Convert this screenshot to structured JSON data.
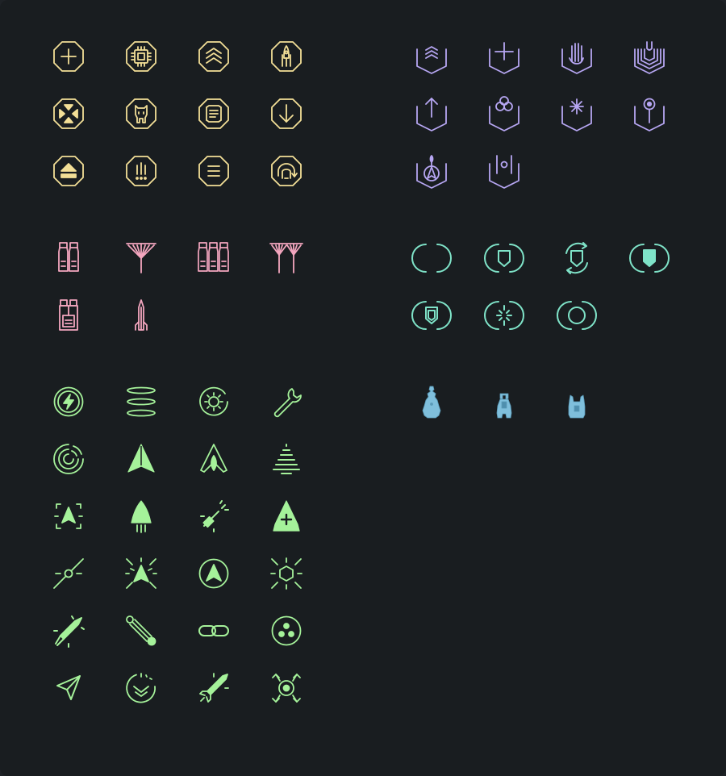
{
  "colors": {
    "background": "#191d20",
    "yellow": "#f3df97",
    "purple": "#b6a6f2",
    "pink": "#f4a6bf",
    "teal": "#7fe3c8",
    "blue": "#7fbfdc",
    "green": "#a5f29a"
  },
  "groups": [
    {
      "name": "yellow-octagon-icons",
      "color": "yellow",
      "icons": [
        "octagon-plus-icon",
        "octagon-chip-icon",
        "octagon-chevrons-up-icon",
        "octagon-rocket-icon",
        "octagon-target-icon",
        "octagon-robot-icon",
        "octagon-document-icon",
        "octagon-arrow-down-icon",
        "octagon-eject-icon",
        "octagon-alert-icon",
        "octagon-menu-icon",
        "octagon-refresh-icon"
      ]
    },
    {
      "name": "purple-shield-icons",
      "color": "purple",
      "icons": [
        "shield-chevrons-icon",
        "shield-plus-icon",
        "shield-hand-icon",
        "shield-layers-icon",
        "shield-arrow-up-icon",
        "shield-rings-icon",
        "shield-star-icon",
        "shield-pin-icon",
        "shield-rocket-icon",
        "shield-bar-icon"
      ]
    },
    {
      "name": "pink-structure-icons",
      "color": "pink",
      "icons": [
        "twin-tanks-icon",
        "single-antenna-icon",
        "triple-tanks-icon",
        "twin-antenna-icon",
        "tank-cluster-icon",
        "tower-spike-icon"
      ]
    },
    {
      "name": "teal-bracket-icons",
      "color": "teal",
      "icons": [
        "brackets-empty-icon",
        "brackets-shield-icon",
        "shield-cycle-icon",
        "brackets-shield-filled-icon",
        "brackets-shield-double-icon",
        "brackets-sparkle-icon",
        "brackets-ring-icon"
      ]
    },
    {
      "name": "blue-figure-icons",
      "color": "blue",
      "icons": [
        "figure-bulky-icon",
        "figure-slim-icon",
        "figure-horned-icon"
      ]
    },
    {
      "name": "green-ship-icons",
      "color": "green",
      "icons": [
        "power-bolt-icon",
        "rings-stack-icon",
        "gear-circle-icon",
        "wrench-icon",
        "radar-icon",
        "ship-arrow-icon",
        "ship-flame-icon",
        "ship-striped-icon",
        "ship-target-icon",
        "ship-thrust-icon",
        "laser-gun-icon",
        "ship-plus-icon",
        "crosshair-line-icon",
        "ship-burst-icon",
        "ship-circle-icon",
        "hex-burst-icon",
        "rocket-launch-icon",
        "probe-link-icon",
        "chain-link-icon",
        "triple-dot-circle-icon",
        "send-arrow-icon",
        "dial-chevron-icon",
        "missile-icon",
        "core-burst-icon"
      ]
    }
  ]
}
